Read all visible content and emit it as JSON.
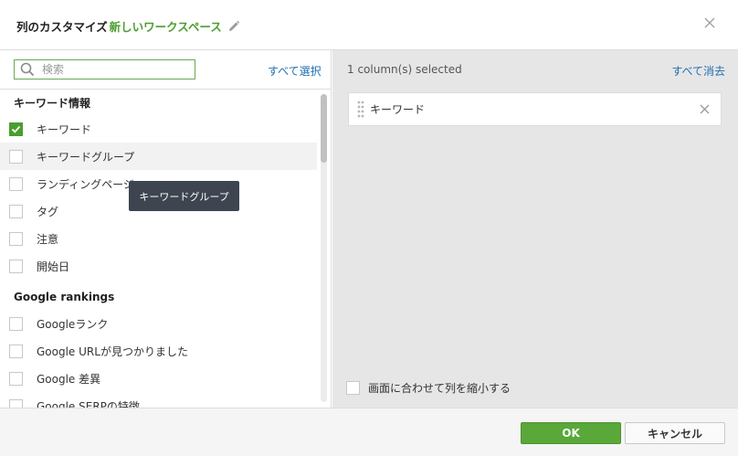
{
  "dialog": {
    "title": "列のカスタマイズ",
    "workspace_name": "新しいワークスペース",
    "icons": {
      "edit": "pencil-icon",
      "close": "close-icon"
    }
  },
  "left": {
    "search": {
      "placeholder": "検索",
      "value": "",
      "icon": "search-icon"
    },
    "select_all": "すべて選択",
    "groups": [
      {
        "label": "キーワード情報",
        "items": [
          {
            "label": "キーワード",
            "checked": true
          },
          {
            "label": "キーワードグループ",
            "checked": false
          },
          {
            "label": "ランディングページ",
            "checked": false
          },
          {
            "label": "タグ",
            "checked": false
          },
          {
            "label": "注意",
            "checked": false
          },
          {
            "label": "開始日",
            "checked": false
          }
        ]
      },
      {
        "label": "Google rankings",
        "items": [
          {
            "label": "Googleランク",
            "checked": false
          },
          {
            "label": "Google URLが見つかりました",
            "checked": false
          },
          {
            "label": "Google 差異",
            "checked": false
          },
          {
            "label": "Google SERPの特徴",
            "checked": false
          }
        ]
      }
    ],
    "tooltip": "キーワードグループ"
  },
  "right": {
    "selected_count": "1 column(s) selected",
    "clear_all": "すべて消去",
    "selected_items": [
      {
        "label": "キーワード"
      }
    ],
    "icons": {
      "drag": "drag-handle-icon",
      "remove": "remove-icon"
    },
    "fit_to_screen": {
      "label": "画面に合わせて列を縮小する",
      "checked": false
    }
  },
  "footer": {
    "ok": "OK",
    "cancel": "キャンセル"
  },
  "colors": {
    "accent_green": "#4a9e2f",
    "ok_button": "#5aa83a",
    "link_blue": "#1f6fb2",
    "tooltip_bg": "#3e4550",
    "right_panel_bg": "#e6e6e6"
  }
}
